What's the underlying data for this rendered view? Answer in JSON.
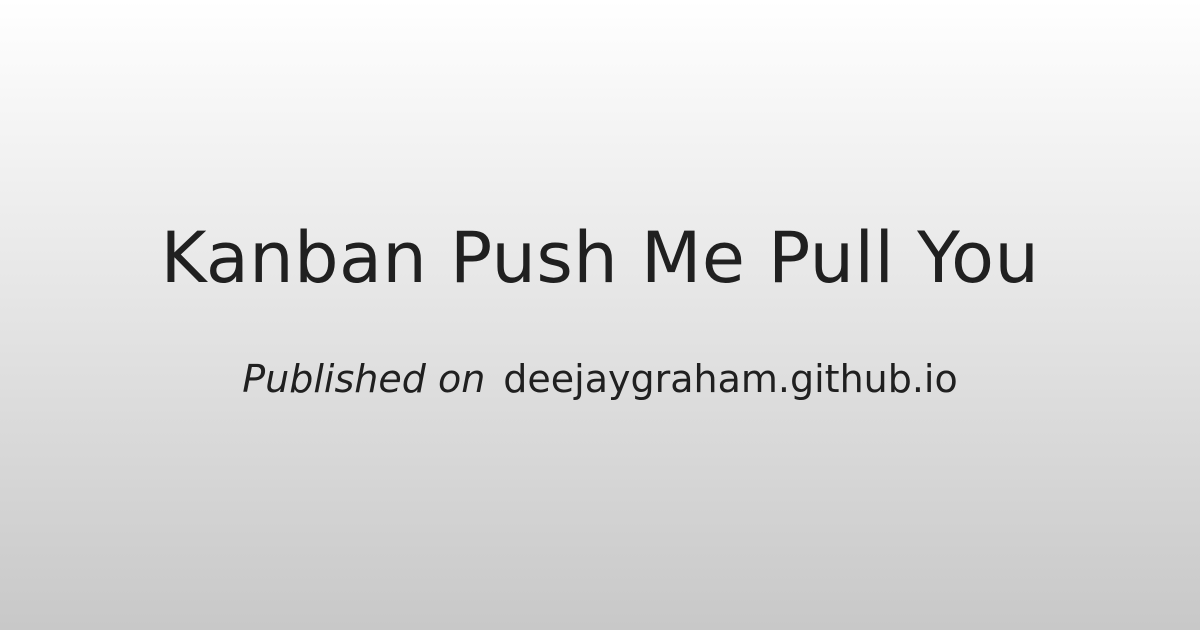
{
  "title": "Kanban Push Me Pull You",
  "byline": {
    "prefix": "Published on",
    "site": "deejaygraham.github.io"
  },
  "colors": {
    "background_top": "#ffffff",
    "background_bottom": "#c8c8c8",
    "text": "#202020"
  }
}
